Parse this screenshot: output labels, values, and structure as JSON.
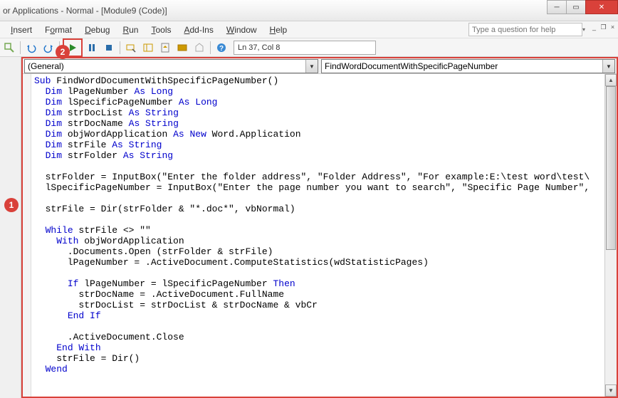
{
  "titlebar": {
    "text": "or Applications - Normal - [Module9 (Code)]"
  },
  "menu": {
    "insert": "Insert",
    "format": "Format",
    "debug": "Debug",
    "run": "Run",
    "tools": "Tools",
    "addins": "Add-Ins",
    "window": "Window",
    "help": "Help"
  },
  "help_search": {
    "placeholder": "Type a question for help"
  },
  "toolbar": {
    "status": "Ln 37, Col 8"
  },
  "dropdowns": {
    "left": "(General)",
    "right": "FindWordDocumentWithSpecificPageNumber"
  },
  "annotations": {
    "badge1": "1",
    "badge2": "2"
  },
  "code": {
    "lines": [
      {
        "indent": 0,
        "parts": [
          {
            "t": "Sub ",
            "k": 1
          },
          {
            "t": "FindWordDocumentWithSpecificPageNumber()"
          }
        ]
      },
      {
        "indent": 1,
        "parts": [
          {
            "t": "Dim ",
            "k": 1
          },
          {
            "t": "lPageNumber "
          },
          {
            "t": "As Long",
            "k": 1
          }
        ]
      },
      {
        "indent": 1,
        "parts": [
          {
            "t": "Dim ",
            "k": 1
          },
          {
            "t": "lSpecificPageNumber "
          },
          {
            "t": "As Long",
            "k": 1
          }
        ]
      },
      {
        "indent": 1,
        "parts": [
          {
            "t": "Dim ",
            "k": 1
          },
          {
            "t": "strDocList "
          },
          {
            "t": "As String",
            "k": 1
          }
        ]
      },
      {
        "indent": 1,
        "parts": [
          {
            "t": "Dim ",
            "k": 1
          },
          {
            "t": "strDocName "
          },
          {
            "t": "As String",
            "k": 1
          }
        ]
      },
      {
        "indent": 1,
        "parts": [
          {
            "t": "Dim ",
            "k": 1
          },
          {
            "t": "objWordApplication "
          },
          {
            "t": "As New ",
            "k": 1
          },
          {
            "t": "Word.Application"
          }
        ]
      },
      {
        "indent": 1,
        "parts": [
          {
            "t": "Dim ",
            "k": 1
          },
          {
            "t": "strFile "
          },
          {
            "t": "As String",
            "k": 1
          }
        ]
      },
      {
        "indent": 1,
        "parts": [
          {
            "t": "Dim ",
            "k": 1
          },
          {
            "t": "strFolder "
          },
          {
            "t": "As String",
            "k": 1
          }
        ]
      },
      {
        "indent": 0,
        "parts": [
          {
            "t": ""
          }
        ]
      },
      {
        "indent": 1,
        "parts": [
          {
            "t": "strFolder = InputBox(\"Enter the folder address\", \"Folder Address\", \"For example:E:\\test word\\test\\"
          }
        ]
      },
      {
        "indent": 1,
        "parts": [
          {
            "t": "lSpecificPageNumber = InputBox(\"Enter the page number you want to search\", \"Specific Page Number\","
          }
        ]
      },
      {
        "indent": 0,
        "parts": [
          {
            "t": ""
          }
        ]
      },
      {
        "indent": 1,
        "parts": [
          {
            "t": "strFile = Dir(strFolder & \"*.doc*\", vbNormal)"
          }
        ]
      },
      {
        "indent": 0,
        "parts": [
          {
            "t": ""
          }
        ]
      },
      {
        "indent": 1,
        "parts": [
          {
            "t": "While ",
            "k": 1
          },
          {
            "t": "strFile <> \"\""
          }
        ]
      },
      {
        "indent": 2,
        "parts": [
          {
            "t": "With ",
            "k": 1
          },
          {
            "t": "objWordApplication"
          }
        ]
      },
      {
        "indent": 3,
        "parts": [
          {
            "t": ".Documents.Open (strFolder & strFile)"
          }
        ]
      },
      {
        "indent": 3,
        "parts": [
          {
            "t": "lPageNumber = .ActiveDocument.ComputeStatistics(wdStatisticPages)"
          }
        ]
      },
      {
        "indent": 0,
        "parts": [
          {
            "t": ""
          }
        ]
      },
      {
        "indent": 3,
        "parts": [
          {
            "t": "If ",
            "k": 1
          },
          {
            "t": "lPageNumber = lSpecificPageNumber "
          },
          {
            "t": "Then",
            "k": 1
          }
        ]
      },
      {
        "indent": 4,
        "parts": [
          {
            "t": "strDocName = .ActiveDocument.FullName"
          }
        ]
      },
      {
        "indent": 4,
        "parts": [
          {
            "t": "strDocList = strDocList & strDocName & vbCr"
          }
        ]
      },
      {
        "indent": 3,
        "parts": [
          {
            "t": "End If",
            "k": 1
          }
        ]
      },
      {
        "indent": 0,
        "parts": [
          {
            "t": ""
          }
        ]
      },
      {
        "indent": 3,
        "parts": [
          {
            "t": ".ActiveDocument.Close"
          }
        ]
      },
      {
        "indent": 2,
        "parts": [
          {
            "t": "End With",
            "k": 1
          }
        ]
      },
      {
        "indent": 2,
        "parts": [
          {
            "t": "strFile = Dir()"
          }
        ]
      },
      {
        "indent": 1,
        "parts": [
          {
            "t": "Wend",
            "k": 1
          }
        ]
      }
    ]
  }
}
